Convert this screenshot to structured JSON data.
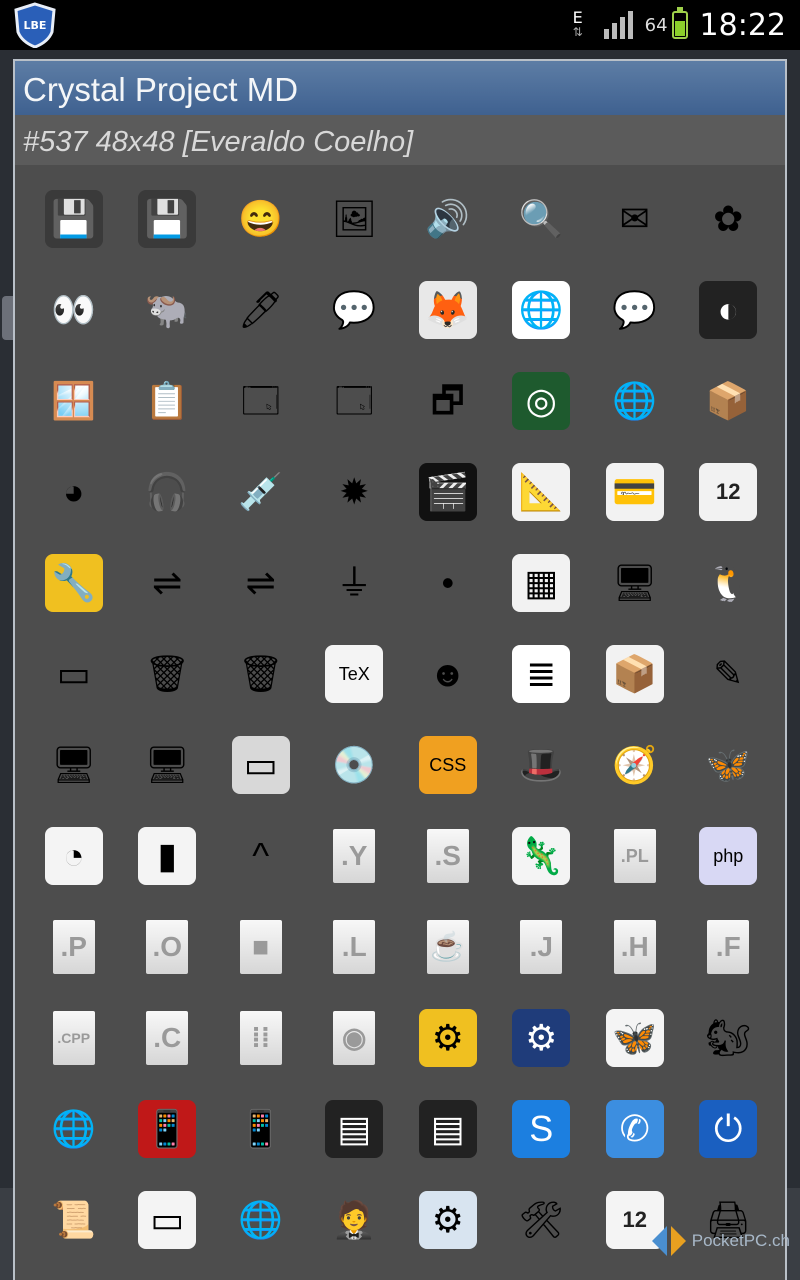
{
  "status_bar": {
    "app_badge": "LBE",
    "network_type": "E",
    "battery_percent": "64",
    "time": "18:22",
    "signal_bars": 4
  },
  "dialog": {
    "title": "Crystal Project MD",
    "subtitle": "#537 48x48 [Everaldo Coelho]"
  },
  "icons": [
    {
      "name": "zip-floppy-icon",
      "glyph": "💾",
      "bg": "#3a3a3a"
    },
    {
      "name": "zip-floppy-add-icon",
      "glyph": "💾",
      "bg": "#3a3a3a"
    },
    {
      "name": "yahoo-messenger-icon",
      "glyph": "😄",
      "bg": "transparent"
    },
    {
      "name": "image-editor-icon",
      "glyph": "🖼",
      "bg": "transparent"
    },
    {
      "name": "sound-speaker-icon",
      "glyph": "🔊",
      "bg": "transparent"
    },
    {
      "name": "magnifier-icon",
      "glyph": "🔍",
      "bg": "transparent"
    },
    {
      "name": "mail-envelope-icon",
      "glyph": "✉",
      "bg": "transparent"
    },
    {
      "name": "xfig-icon",
      "glyph": "✿",
      "bg": "transparent"
    },
    {
      "name": "eyes-icon",
      "glyph": "👀",
      "bg": "transparent"
    },
    {
      "name": "gnu-icon",
      "glyph": "🐃",
      "bg": "transparent"
    },
    {
      "name": "pen-icon",
      "glyph": "🖊",
      "bg": "transparent"
    },
    {
      "name": "penguin-chat-icon",
      "glyph": "💬",
      "bg": "transparent"
    },
    {
      "name": "gimp-icon",
      "glyph": "🦊",
      "bg": "#e8e8e8"
    },
    {
      "name": "web-document-icon",
      "glyph": "🌐",
      "bg": "#ffffff"
    },
    {
      "name": "chat-bubble-icon",
      "glyph": "💬",
      "bg": "transparent"
    },
    {
      "name": "gnome-icon",
      "glyph": "◐",
      "bg": "#222222"
    },
    {
      "name": "windows-wine-icon",
      "glyph": "🪟",
      "bg": "transparent"
    },
    {
      "name": "chalkboard-icon",
      "glyph": "📋",
      "bg": "transparent"
    },
    {
      "name": "kde-windows-icon",
      "glyph": "🗔",
      "bg": "transparent"
    },
    {
      "name": "windows-stack-icon",
      "glyph": "🗔",
      "bg": "transparent"
    },
    {
      "name": "windows-cascade-icon",
      "glyph": "🗗",
      "bg": "transparent"
    },
    {
      "name": "radar-icon",
      "glyph": "◎",
      "bg": "#1e5a2e"
    },
    {
      "name": "globe-icon",
      "glyph": "🌐",
      "bg": "transparent"
    },
    {
      "name": "package-box-icon",
      "glyph": "📦",
      "bg": "transparent"
    },
    {
      "name": "pie-chart-icon",
      "glyph": "◕",
      "bg": "transparent"
    },
    {
      "name": "headphones-icon",
      "glyph": "🎧",
      "bg": "transparent"
    },
    {
      "name": "syringe-icon",
      "glyph": "💉",
      "bg": "transparent"
    },
    {
      "name": "virus-icon",
      "glyph": "✹",
      "bg": "transparent"
    },
    {
      "name": "clapperboard-icon",
      "glyph": "🎬",
      "bg": "#111111"
    },
    {
      "name": "drawing-document-icon",
      "glyph": "📐",
      "bg": "#f2f2f2"
    },
    {
      "name": "credit-card-icon",
      "glyph": "💳",
      "bg": "#f2f2f2"
    },
    {
      "name": "calendar-12-icon",
      "glyph": "12",
      "bg": "#f2f2f2"
    },
    {
      "name": "wrench-icon",
      "glyph": "🔧",
      "bg": "#f0c020"
    },
    {
      "name": "usb-stick-icon",
      "glyph": "⇌",
      "bg": "transparent"
    },
    {
      "name": "usb-stick-mounted-icon",
      "glyph": "⇌",
      "bg": "transparent"
    },
    {
      "name": "usb-connector-icon",
      "glyph": "⏚",
      "bg": "transparent"
    },
    {
      "name": "red-dot-icon",
      "glyph": "•",
      "bg": "transparent"
    },
    {
      "name": "spreadsheet-document-icon",
      "glyph": "▦",
      "bg": "#f2f2f2"
    },
    {
      "name": "monitor-icon",
      "glyph": "🖥",
      "bg": "transparent"
    },
    {
      "name": "tux-penguin-icon",
      "glyph": "🐧",
      "bg": "transparent"
    },
    {
      "name": "green-board-icon",
      "glyph": "▭",
      "bg": "transparent"
    },
    {
      "name": "trash-full-icon",
      "glyph": "🗑",
      "bg": "transparent"
    },
    {
      "name": "trash-empty-icon",
      "glyph": "🗑",
      "bg": "transparent"
    },
    {
      "name": "tex-document-icon",
      "glyph": "TeX",
      "bg": "#f4f4f4"
    },
    {
      "name": "crash-dummy-icon",
      "glyph": "☻",
      "bg": "transparent"
    },
    {
      "name": "text-document-icon",
      "glyph": "≣",
      "bg": "#ffffff"
    },
    {
      "name": "cardboard-box-icon",
      "glyph": "📦",
      "bg": "#f2f2f2"
    },
    {
      "name": "graphics-tablet-icon",
      "glyph": "✎",
      "bg": "transparent"
    },
    {
      "name": "desktop-computer-icon",
      "glyph": "🖥",
      "bg": "transparent"
    },
    {
      "name": "network-card-icon",
      "glyph": "🖥",
      "bg": "transparent"
    },
    {
      "name": "touchpad-icon",
      "glyph": "▭",
      "bg": "#d8d8d8"
    },
    {
      "name": "kde-install-cd-icon",
      "glyph": "💿",
      "bg": "transparent"
    },
    {
      "name": "css-icon",
      "glyph": "CSS",
      "bg": "#f0a020"
    },
    {
      "name": "magic-hat-icon",
      "glyph": "🎩",
      "bg": "transparent"
    },
    {
      "name": "blueprint-compass-icon",
      "glyph": "🧭",
      "bg": "transparent"
    },
    {
      "name": "butterfly-icon",
      "glyph": "🦋",
      "bg": "transparent"
    },
    {
      "name": "spreadsheet-chart-icon",
      "glyph": "◔",
      "bg": "#f4f4f4"
    },
    {
      "name": "bar-chart-icon",
      "glyph": "▮",
      "bg": "#f4f4f4"
    },
    {
      "name": "kde-chevron-icon",
      "glyph": "^",
      "bg": "transparent"
    },
    {
      "name": "y-file-icon",
      "glyph": ".Y",
      "bg": "doc"
    },
    {
      "name": "s-file-icon",
      "glyph": ".S",
      "bg": "doc"
    },
    {
      "name": "lizard-icon",
      "glyph": "🦎",
      "bg": "#f4f4f4"
    },
    {
      "name": "pl-file-icon",
      "glyph": ".PL",
      "bg": "doc"
    },
    {
      "name": "php-file-icon",
      "glyph": "php",
      "bg": "#d8d8f4"
    },
    {
      "name": "p-file-icon",
      "glyph": ".P",
      "bg": "doc"
    },
    {
      "name": "o-file-icon",
      "glyph": ".O",
      "bg": "doc"
    },
    {
      "name": "cubes-file-icon",
      "glyph": "■",
      "bg": "doc"
    },
    {
      "name": "l-file-icon",
      "glyph": ".L",
      "bg": "doc"
    },
    {
      "name": "coffee-cup-icon",
      "glyph": "☕",
      "bg": "doc"
    },
    {
      "name": "j-file-icon",
      "glyph": ".J",
      "bg": "doc"
    },
    {
      "name": "h-file-icon",
      "glyph": ".H",
      "bg": "doc"
    },
    {
      "name": "f-file-icon",
      "glyph": ".F",
      "bg": "doc"
    },
    {
      "name": "cpp-file-icon",
      "glyph": ".CPP",
      "bg": "doc-small"
    },
    {
      "name": "c-file-icon",
      "glyph": ".C",
      "bg": "doc"
    },
    {
      "name": "binary-file-icon",
      "glyph": "⁞⁞",
      "bg": "doc"
    },
    {
      "name": "audio-file-icon",
      "glyph": "◉",
      "bg": "doc"
    },
    {
      "name": "yellow-gear-icon",
      "glyph": "⚙",
      "bg": "#f0c020"
    },
    {
      "name": "blue-gear-icon",
      "glyph": "⚙",
      "bg": "#1f3c7a"
    },
    {
      "name": "butterfly-document-icon",
      "glyph": "🦋",
      "bg": "#f4f4f4"
    },
    {
      "name": "chipmunk-icon",
      "glyph": "🐿",
      "bg": "transparent"
    },
    {
      "name": "network-globe-plug-icon",
      "glyph": "🌐",
      "bg": "transparent"
    },
    {
      "name": "red-cellphone-icon",
      "glyph": "📱",
      "bg": "#c01818"
    },
    {
      "name": "mobile-phone-icon",
      "glyph": "📱",
      "bg": "transparent"
    },
    {
      "name": "sd-card-icon",
      "glyph": "▤",
      "bg": "#222222"
    },
    {
      "name": "sd-card-mounted-icon",
      "glyph": "▤",
      "bg": "#222222"
    },
    {
      "name": "skype-icon",
      "glyph": "S",
      "bg": "#1c7fe0"
    },
    {
      "name": "phone-call-icon",
      "glyph": "✆",
      "bg": "#3c8ee0"
    },
    {
      "name": "power-button-icon",
      "glyph": "⏻",
      "bg": "#1a5fc0"
    },
    {
      "name": "scroll-paper-icon",
      "glyph": "📜",
      "bg": "transparent"
    },
    {
      "name": "display-window-icon",
      "glyph": "▭",
      "bg": "#f4f4f4"
    },
    {
      "name": "web-hosting-icon",
      "glyph": "🌐",
      "bg": "transparent"
    },
    {
      "name": "tuxedo-icon",
      "glyph": "🤵",
      "bg": "transparent"
    },
    {
      "name": "system-settings-icon",
      "glyph": "⚙",
      "bg": "#d8e4f0"
    },
    {
      "name": "tools-gear-icon",
      "glyph": "🛠",
      "bg": "transparent"
    },
    {
      "name": "calendar-sep-12-icon",
      "glyph": "12",
      "bg": "#f4f4f4"
    },
    {
      "name": "scanner-icon",
      "glyph": "🖨",
      "bg": "transparent"
    }
  ],
  "watermark": {
    "text": "PocketPC.ch"
  }
}
